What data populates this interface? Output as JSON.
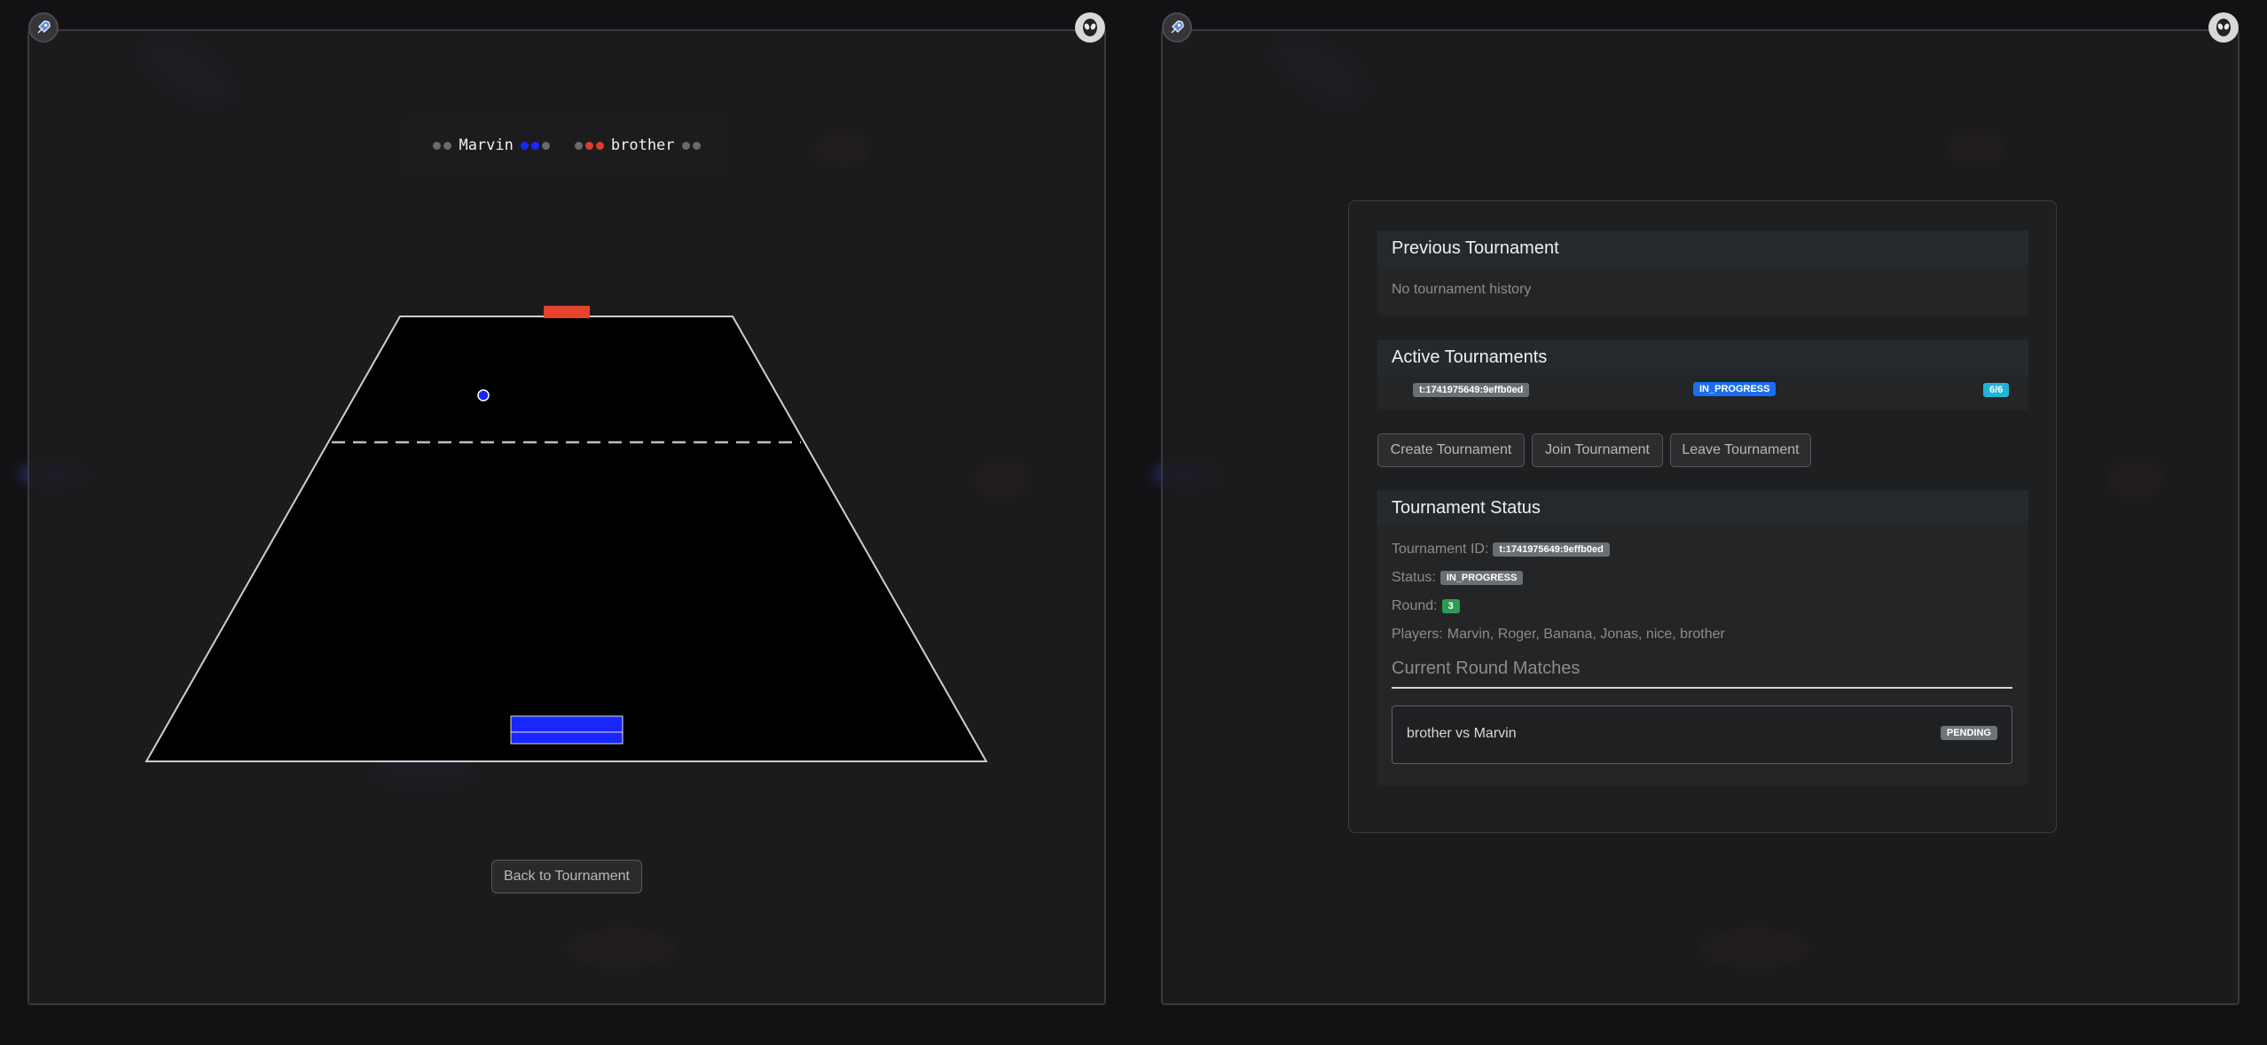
{
  "left_window": {
    "scoreboard": {
      "player_left": "Marvin",
      "player_right": "brother",
      "left_inactive_dots": 2,
      "left_score_dots": 2,
      "right_score_dots": 2,
      "right_inactive_dots": 2
    },
    "colors": {
      "player_blue": "#1826ff",
      "player_red": "#e43a2a",
      "court": "#000000"
    },
    "back_button": "Back to Tournament"
  },
  "right_window": {
    "previous_tournament": {
      "title": "Previous Tournament",
      "empty_text": "No tournament history"
    },
    "active_tournaments": {
      "title": "Active Tournaments",
      "rows": [
        {
          "id": "t:1741975649:9effb0ed",
          "status": "IN_PROGRESS",
          "count": "6/6"
        }
      ]
    },
    "buttons": {
      "create": "Create Tournament",
      "join": "Join Tournament",
      "leave": "Leave Tournament"
    },
    "tournament_status": {
      "title": "Tournament Status",
      "id_label": "Tournament ID:",
      "id_value": "t:1741975649:9effb0ed",
      "status_label": "Status:",
      "status_value": "IN_PROGRESS",
      "round_label": "Round:",
      "round_value": "3",
      "players_label": "Players:",
      "players_value": "Marvin, Roger, Banana, Jonas, nice, brother",
      "current_round_title": "Current Round Matches",
      "matches": [
        {
          "label": "brother vs Marvin",
          "status": "PENDING"
        }
      ]
    }
  },
  "icons": [
    "rocket-icon",
    "alien-icon"
  ]
}
